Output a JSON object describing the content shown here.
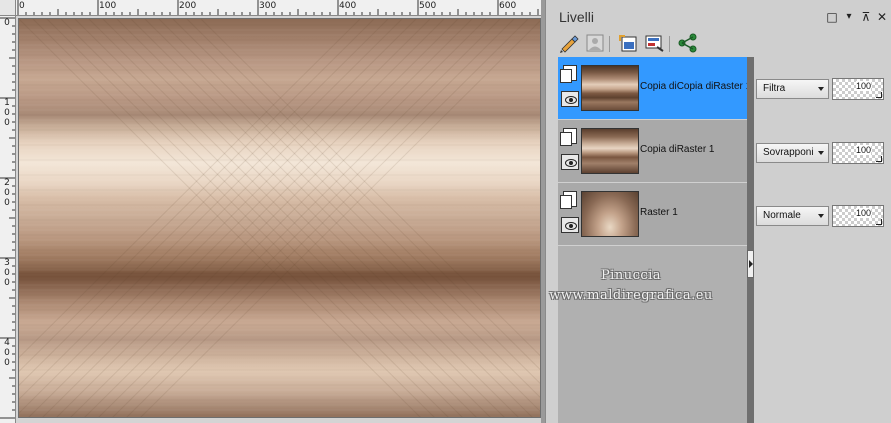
{
  "ruler": {
    "top_labels": [
      "0",
      "100",
      "200",
      "300",
      "400",
      "500",
      "600"
    ],
    "left_labels": [
      [
        "0"
      ],
      [
        "1",
        "0",
        "0"
      ],
      [
        "2",
        "0",
        "0"
      ],
      [
        "3",
        "0",
        "0"
      ],
      [
        "4",
        "0",
        "0"
      ]
    ]
  },
  "panel": {
    "title": "Livelli",
    "window_buttons": {
      "maximize": "□",
      "menu": "▾",
      "pin": "⊼",
      "close": "✕"
    },
    "toolbar_icons": [
      "paint-brush-icon",
      "mask-icon",
      "layer-properties-icon",
      "layer-edit-icon",
      "link-share-icon"
    ]
  },
  "layers": [
    {
      "name": "Copia diCopia diRaster 1",
      "blend_mode": "Filtra",
      "opacity": "100",
      "selected": true
    },
    {
      "name": "Copia diRaster 1",
      "blend_mode": "Sovrapponi",
      "opacity": "100",
      "selected": false
    },
    {
      "name": "Raster 1",
      "blend_mode": "Normale",
      "opacity": "100",
      "selected": false
    }
  ],
  "watermark": {
    "line1": "Pinuccia",
    "line2": "www.maldiregrafica.eu"
  },
  "colors": {
    "selection": "#3399ff",
    "panel_bg": "#cfcfcf"
  }
}
